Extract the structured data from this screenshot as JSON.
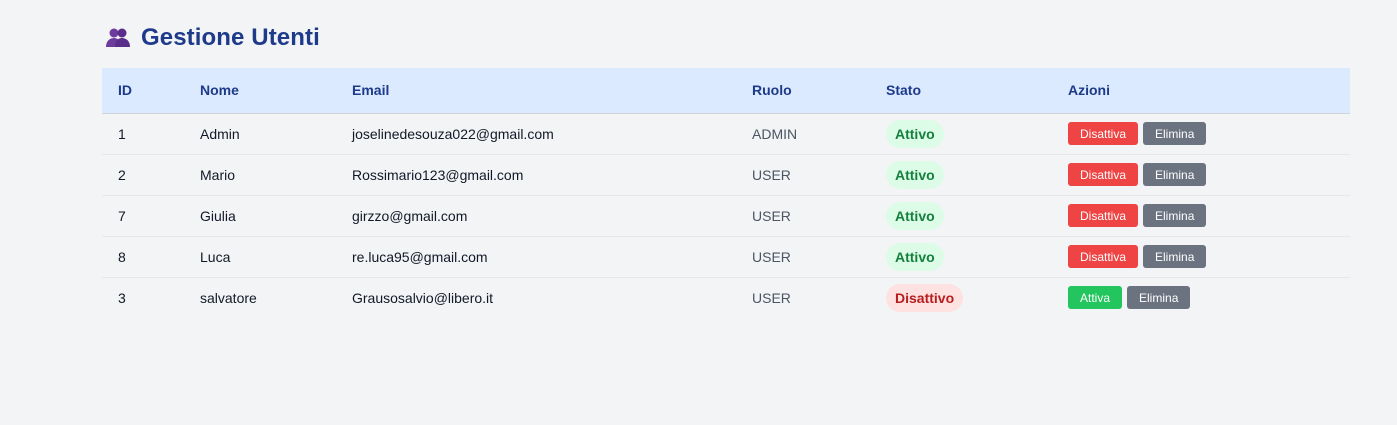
{
  "page": {
    "title": "Gestione Utenti",
    "icon": "users-icon"
  },
  "table": {
    "headers": {
      "id": "ID",
      "name": "Nome",
      "email": "Email",
      "role": "Ruolo",
      "status": "Stato",
      "actions": "Azioni"
    },
    "rows": [
      {
        "id": "1",
        "name": "Admin",
        "email": "joselinedesouza022@gmail.com",
        "role": "ADMIN",
        "status": "Attivo",
        "toggle_label": "Disattiva",
        "delete_label": "Elimina"
      },
      {
        "id": "2",
        "name": "Mario",
        "email": "Rossimario123@gmail.com",
        "role": "USER",
        "status": "Attivo",
        "toggle_label": "Disattiva",
        "delete_label": "Elimina"
      },
      {
        "id": "7",
        "name": "Giulia",
        "email": "girzzo@gmail.com",
        "role": "USER",
        "status": "Attivo",
        "toggle_label": "Disattiva",
        "delete_label": "Elimina"
      },
      {
        "id": "8",
        "name": "Luca",
        "email": "re.luca95@gmail.com",
        "role": "USER",
        "status": "Attivo",
        "toggle_label": "Disattiva",
        "delete_label": "Elimina"
      },
      {
        "id": "3",
        "name": "salvatore",
        "email": "Grausosalvio@libero.it",
        "role": "USER",
        "status": "Disattivo",
        "toggle_label": "Attiva",
        "delete_label": "Elimina"
      }
    ]
  },
  "colors": {
    "title": "#1e3a8a",
    "header_bg": "#dbeafe",
    "active_badge_bg": "#dcfce7",
    "active_badge_text": "#15803d",
    "inactive_badge_bg": "#fee2e2",
    "inactive_badge_text": "#b91c1c",
    "deactivate_button": "#ef4444",
    "activate_button": "#22c55e",
    "delete_button": "#6b7280"
  }
}
